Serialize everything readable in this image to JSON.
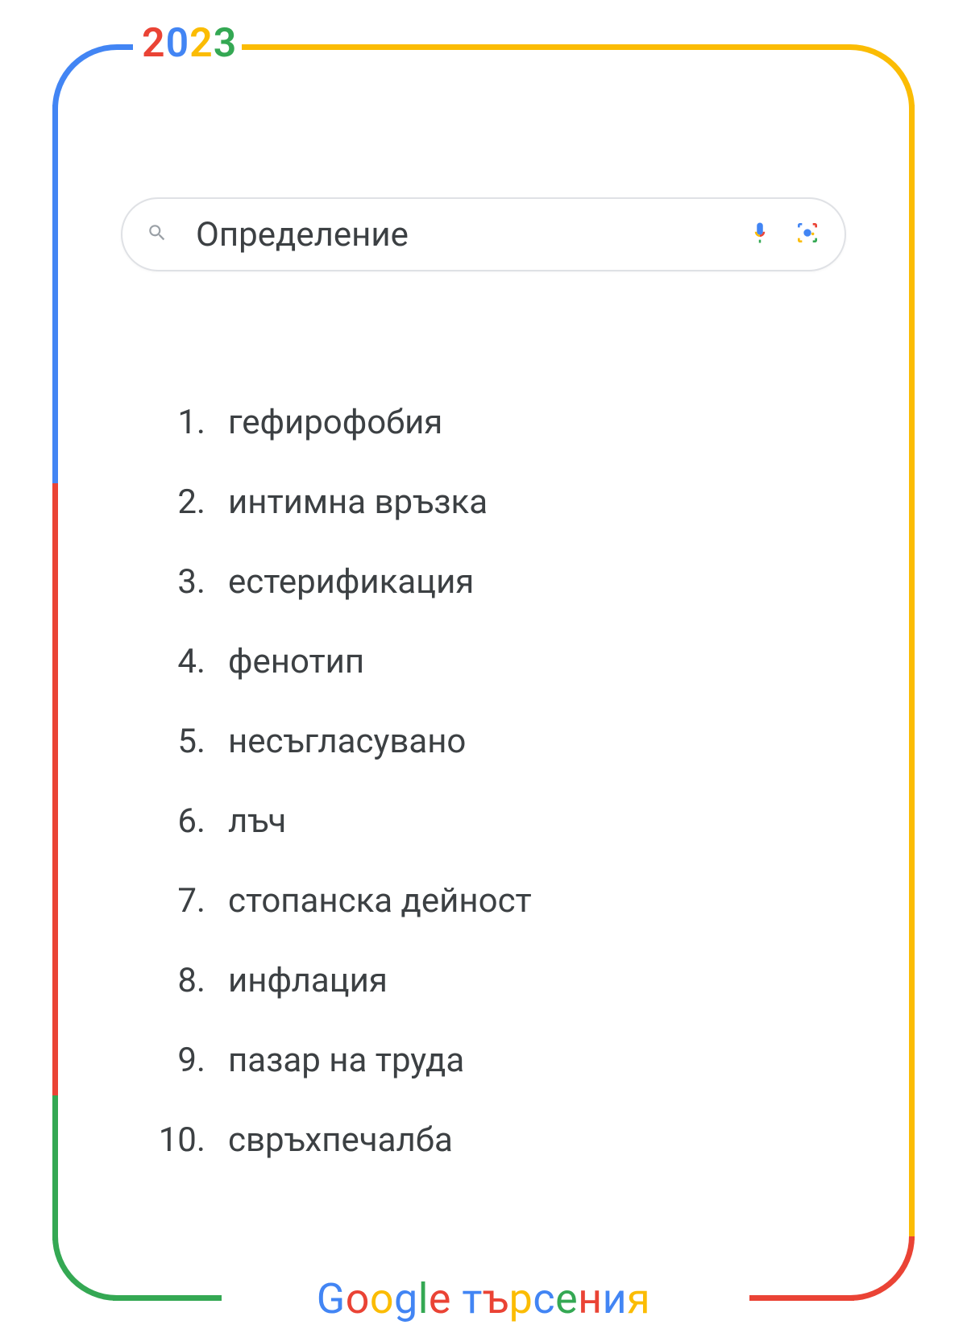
{
  "header": {
    "year": "2023"
  },
  "search": {
    "query": "Определение"
  },
  "ranking": {
    "items": [
      {
        "rank": "1.",
        "term": "гефирофобия"
      },
      {
        "rank": "2.",
        "term": "интимна връзка"
      },
      {
        "rank": "3.",
        "term": "естерификация"
      },
      {
        "rank": "4.",
        "term": "фенотип"
      },
      {
        "rank": "5.",
        "term": "несъгласувано"
      },
      {
        "rank": "6.",
        "term": "лъч"
      },
      {
        "rank": "7.",
        "term": "стопанска дейност"
      },
      {
        "rank": "8.",
        "term": "инфлация"
      },
      {
        "rank": "9.",
        "term": "пазар на труда"
      },
      {
        "rank": "10.",
        "term": "свръхпечалба"
      }
    ]
  },
  "footer": {
    "brand": "Google",
    "tail": "търсения"
  }
}
